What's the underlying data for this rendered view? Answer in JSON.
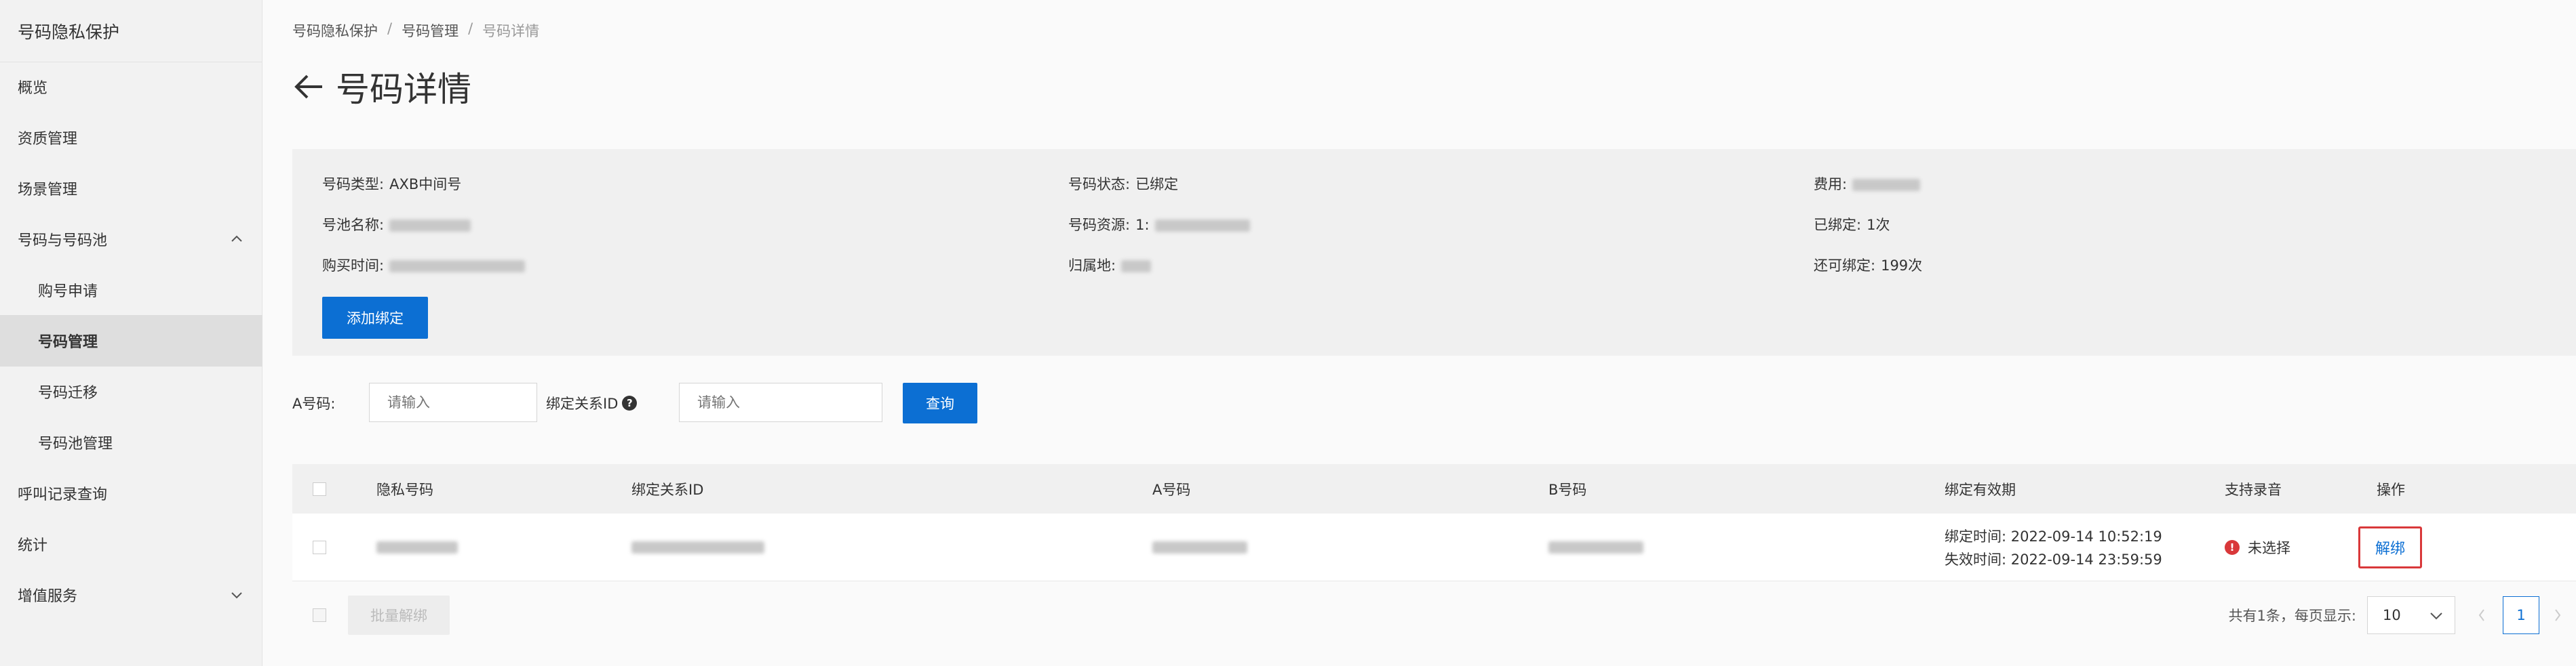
{
  "sidebar": {
    "title": "号码隐私保护",
    "items": [
      {
        "label": "概览"
      },
      {
        "label": "资质管理"
      },
      {
        "label": "场景管理"
      },
      {
        "label": "号码与号码池"
      },
      {
        "label": "购号申请"
      },
      {
        "label": "号码管理"
      },
      {
        "label": "号码迁移"
      },
      {
        "label": "号码池管理"
      },
      {
        "label": "呼叫记录查询"
      },
      {
        "label": "统计"
      },
      {
        "label": "增值服务"
      }
    ]
  },
  "breadcrumb": {
    "items": [
      "号码隐私保护",
      "号码管理",
      "号码详情"
    ],
    "separator": "/"
  },
  "page": {
    "title": "号码详情"
  },
  "info": {
    "type_label": "号码类型:",
    "type_value": "AXB中间号",
    "pool_label": "号池名称:",
    "buy_time_label": "购买时间:",
    "status_label": "号码状态:",
    "status_value": "已绑定",
    "resource_label": "号码资源:",
    "resource_prefix": "1:",
    "region_label": "归属地:",
    "fee_label": "费用:",
    "bound_label": "已绑定:",
    "bound_value": "1次",
    "remaining_label": "还可绑定:",
    "remaining_value": "199次",
    "add_bind_button": "添加绑定"
  },
  "filters": {
    "a_number_label": "A号码:",
    "a_number_placeholder": "请输入",
    "bind_id_label": "绑定关系ID",
    "bind_id_placeholder": "请输入",
    "query_button": "查询"
  },
  "table": {
    "headers": [
      "隐私号码",
      "绑定关系ID",
      "A号码",
      "B号码",
      "绑定有效期",
      "支持录音",
      "操作"
    ],
    "row": {
      "bind_time": "绑定时间:  2022-09-14 10:52:19",
      "expire_time": "失效时间:  2022-09-14 23:59:59",
      "recording": "未选择",
      "action": "解绑"
    },
    "batch_unbind_button": "批量解绑",
    "pager_summary": "共有1条，每页显示:",
    "page_size": "10",
    "current_page": "1"
  },
  "colors": {
    "primary": "#0c6fd3",
    "error": "#d9383a",
    "highlight_border": "#d9383a"
  }
}
